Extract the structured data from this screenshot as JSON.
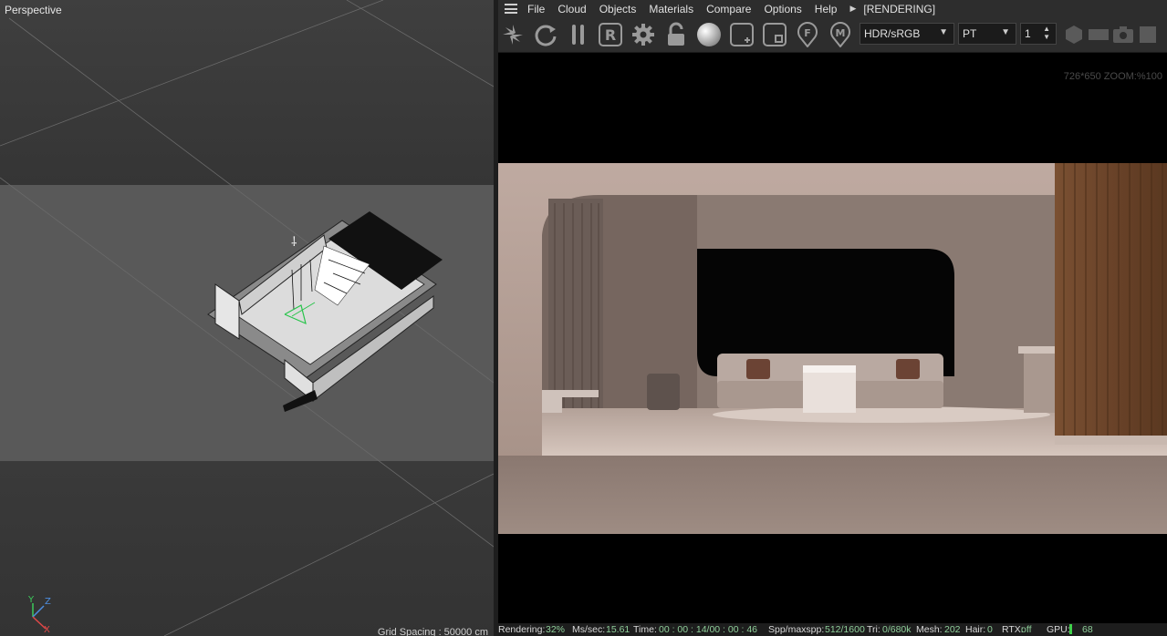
{
  "viewport": {
    "label": "Perspective",
    "grid_spacing": "Grid Spacing : 50000 cm",
    "axes": {
      "y": "Y",
      "z": "Z",
      "x": "X"
    }
  },
  "menu": {
    "items": [
      "File",
      "Cloud",
      "Objects",
      "Materials",
      "Compare",
      "Options",
      "Help"
    ],
    "status": "[RENDERING]"
  },
  "toolbar": {
    "icons": [
      "spinner-icon",
      "refresh-icon",
      "pause-icon",
      "render-region-icon",
      "settings-gear-icon",
      "lock-icon",
      "sphere-icon",
      "add-region-icon",
      "region-icon",
      "focus-pin-icon",
      "material-pin-icon"
    ],
    "icon_letters": {
      "render_region": "R",
      "focus": "F",
      "material": "M"
    },
    "color_space": "HDR/sRGB",
    "kernel": "PT",
    "layer_value": "1"
  },
  "render": {
    "zoom_info": "726*650 ZOOM:%100"
  },
  "status": {
    "rendering_label": "Rendering:",
    "rendering_value": "32%",
    "ms_label": "Ms/sec:",
    "ms_value": "15.61",
    "time_label": "Time:",
    "time_value": "00 : 00 : 14/00 : 00 : 46",
    "spp_label": "Spp/maxspp:",
    "spp_value": "512/1600",
    "tri_label": "Tri:",
    "tri_value": "0/680k",
    "mesh_label": "Mesh:",
    "mesh_value": "202",
    "hair_label": "Hair:",
    "hair_value": "0",
    "rtx_label": "RTX:",
    "rtx_value": "off",
    "gpu_label": "GPU:",
    "gpu_value": "68"
  },
  "colors": {
    "accent_green": "#8fcf9a",
    "panel_bg": "#2d2d2d",
    "viewport_band": "#595959"
  }
}
